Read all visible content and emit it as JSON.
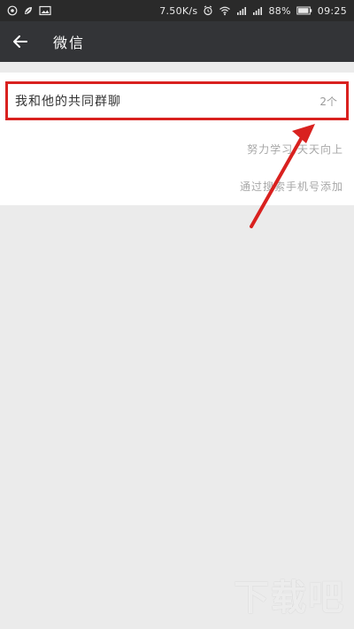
{
  "status_bar": {
    "network_speed": "7.50K/s",
    "battery_percent": "88%",
    "time": "09:25"
  },
  "header": {
    "title": "微信"
  },
  "group_item": {
    "label": "我和他的共同群聊",
    "count": "2个"
  },
  "info_lines": [
    "努力学习,天天向上",
    "通过搜索手机号添加"
  ],
  "watermark": "下载吧",
  "colors": {
    "status_bar_bg": "#2a2a2a",
    "header_bg": "#333437",
    "page_bg": "#ebebeb",
    "highlight": "#d9211f"
  }
}
